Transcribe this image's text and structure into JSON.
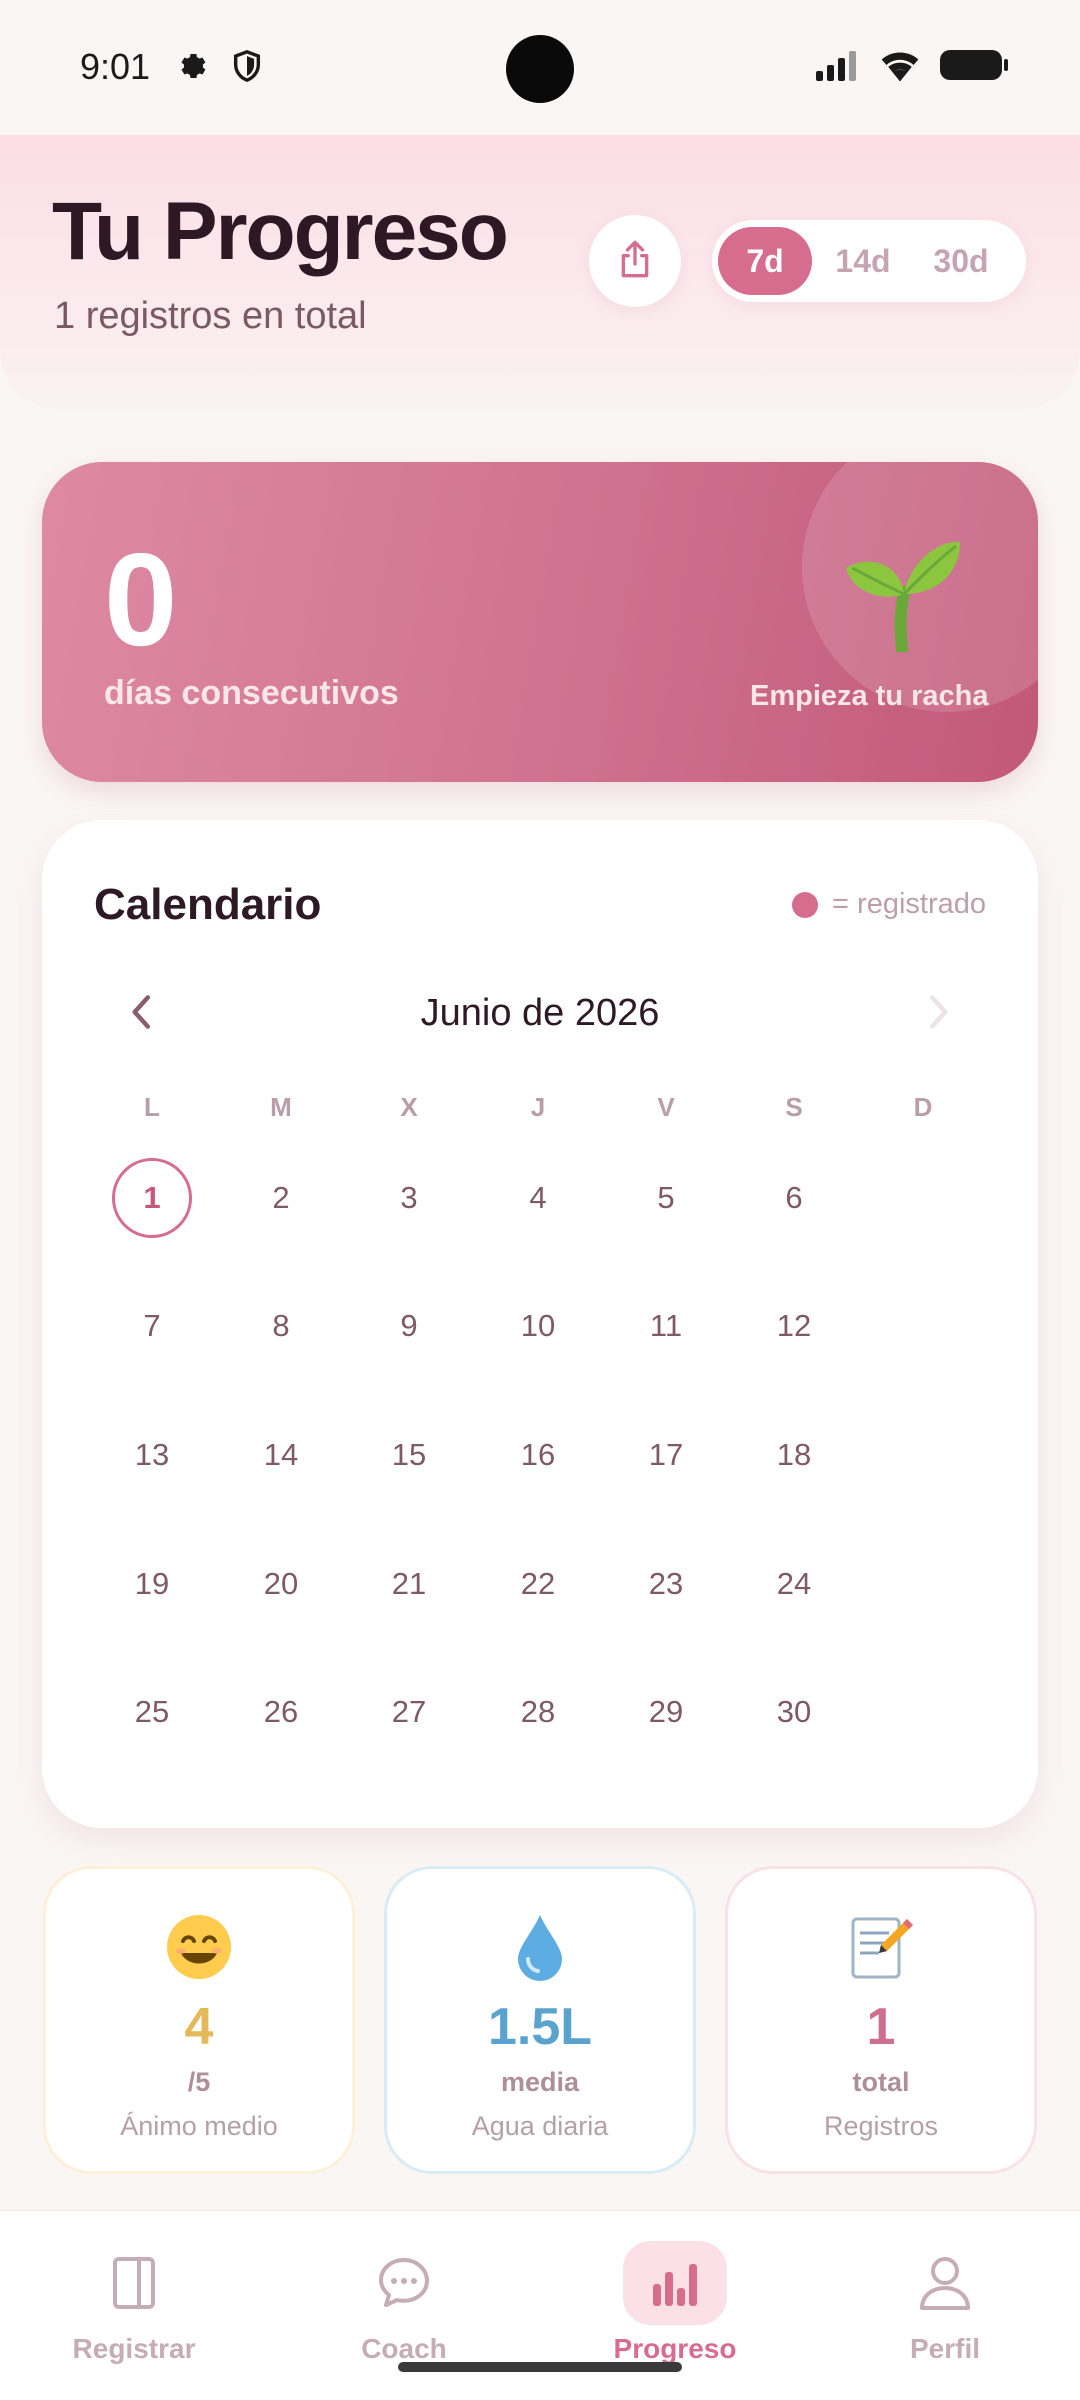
{
  "status_bar": {
    "time": "9:01"
  },
  "header": {
    "title": "Tu Progreso",
    "subtitle": "1 registros en total",
    "range_options": [
      "7d",
      "14d",
      "30d"
    ],
    "range_selected": "7d"
  },
  "streak": {
    "count": "0",
    "label": "días consecutivos",
    "cta": "Empieza tu racha"
  },
  "calendar": {
    "title": "Calendario",
    "legend": "= registrado",
    "month": "Junio de 2026",
    "weekdays": [
      "L",
      "M",
      "X",
      "J",
      "V",
      "S",
      "D"
    ],
    "weeks": [
      [
        "1",
        "2",
        "3",
        "4",
        "5",
        "6",
        ""
      ],
      [
        "7",
        "8",
        "9",
        "10",
        "11",
        "12",
        ""
      ],
      [
        "13",
        "14",
        "15",
        "16",
        "17",
        "18",
        ""
      ],
      [
        "19",
        "20",
        "21",
        "22",
        "23",
        "24",
        ""
      ],
      [
        "25",
        "26",
        "27",
        "28",
        "29",
        "30",
        ""
      ]
    ],
    "highlighted_day": "1"
  },
  "stats": [
    {
      "icon": "smiling-face-icon",
      "value": "4",
      "unit": "/5",
      "label": "Ánimo medio",
      "color": "#e3b95a"
    },
    {
      "icon": "water-drop-icon",
      "value": "1.5L",
      "unit": "media",
      "label": "Agua diaria",
      "color": "#5aa3cf"
    },
    {
      "icon": "memo-icon",
      "value": "1",
      "unit": "total",
      "label": "Registros",
      "color": "#cf6f8f"
    }
  ],
  "nav": {
    "items": [
      {
        "label": "Registrar",
        "icon": "journal-icon"
      },
      {
        "label": "Coach",
        "icon": "chat-bubble-icon"
      },
      {
        "label": "Progreso",
        "icon": "bar-chart-icon"
      },
      {
        "label": "Perfil",
        "icon": "user-icon"
      }
    ],
    "active": "Progreso"
  },
  "colors": {
    "accent": "#d66d8e",
    "background": "#faf6f4"
  }
}
